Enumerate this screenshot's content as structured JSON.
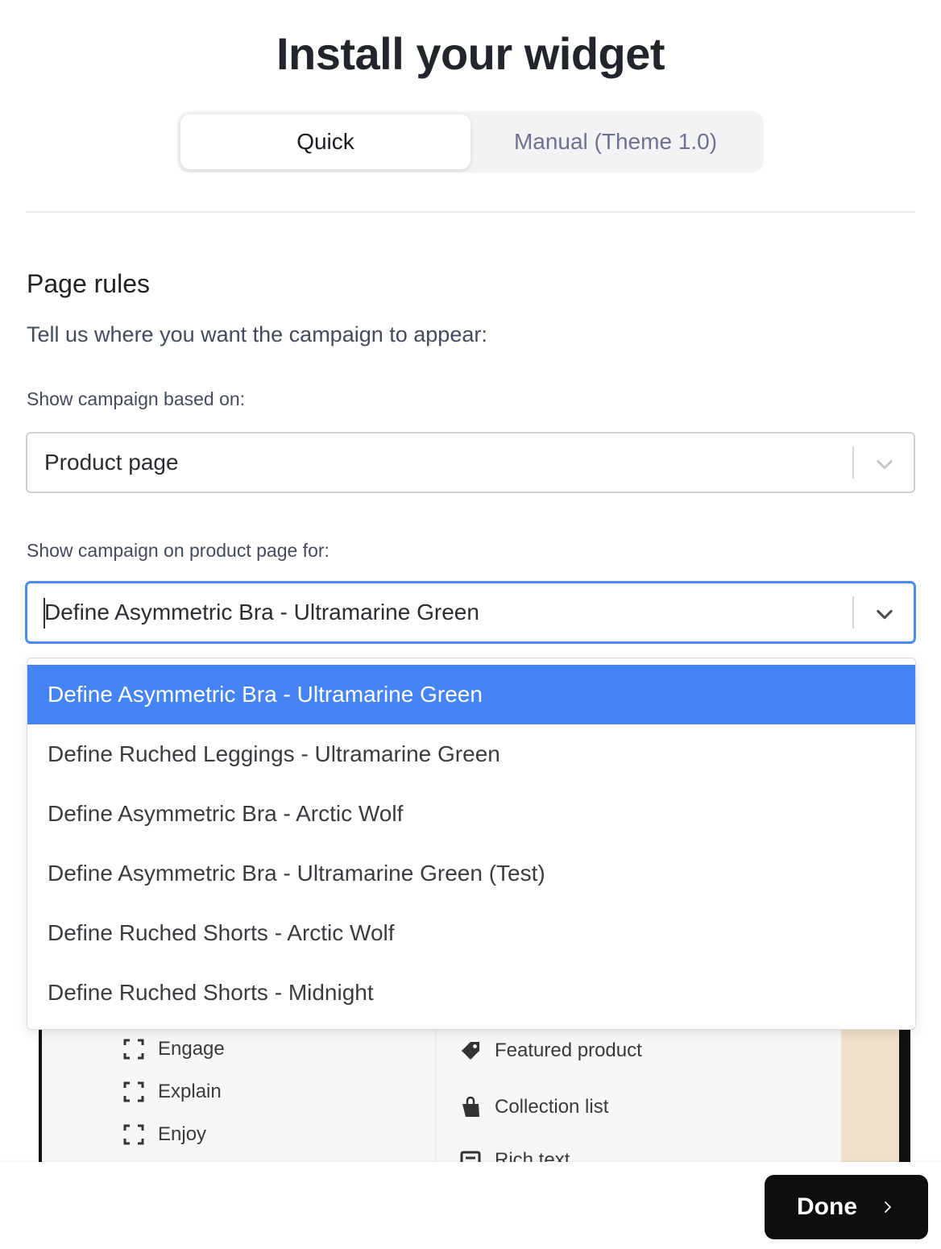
{
  "page": {
    "title": "Install your widget"
  },
  "tabs": {
    "quick": "Quick",
    "manual": "Manual (Theme 1.0)"
  },
  "page_rules": {
    "title": "Page rules",
    "description": "Tell us where you want the campaign to appear:",
    "based_on_label": "Show campaign based on:",
    "based_on_value": "Product page",
    "product_label": "Show campaign on product page for:",
    "product_value": "Define Asymmetric Bra - Ultramarine Green"
  },
  "dropdown": {
    "options": [
      "Define Asymmetric Bra - Ultramarine Green",
      "Define Ruched Leggings - Ultramarine Green",
      "Define Asymmetric Bra - Arctic Wolf",
      "Define Asymmetric Bra - Ultramarine Green (Test)",
      "Define Ruched Shorts - Arctic Wolf",
      "Define Ruched Shorts - Midnight"
    ],
    "selected_index": 0
  },
  "preview": {
    "left_items": [
      "Engage",
      "Explain",
      "Enjoy"
    ],
    "right_items": [
      "Featured product",
      "Collection list",
      "Rich text"
    ]
  },
  "footer": {
    "done_label": "Done"
  },
  "colors": {
    "accent": "#4584f4",
    "focus_border": "#4a8af4",
    "done_bg": "#0e0e10"
  }
}
